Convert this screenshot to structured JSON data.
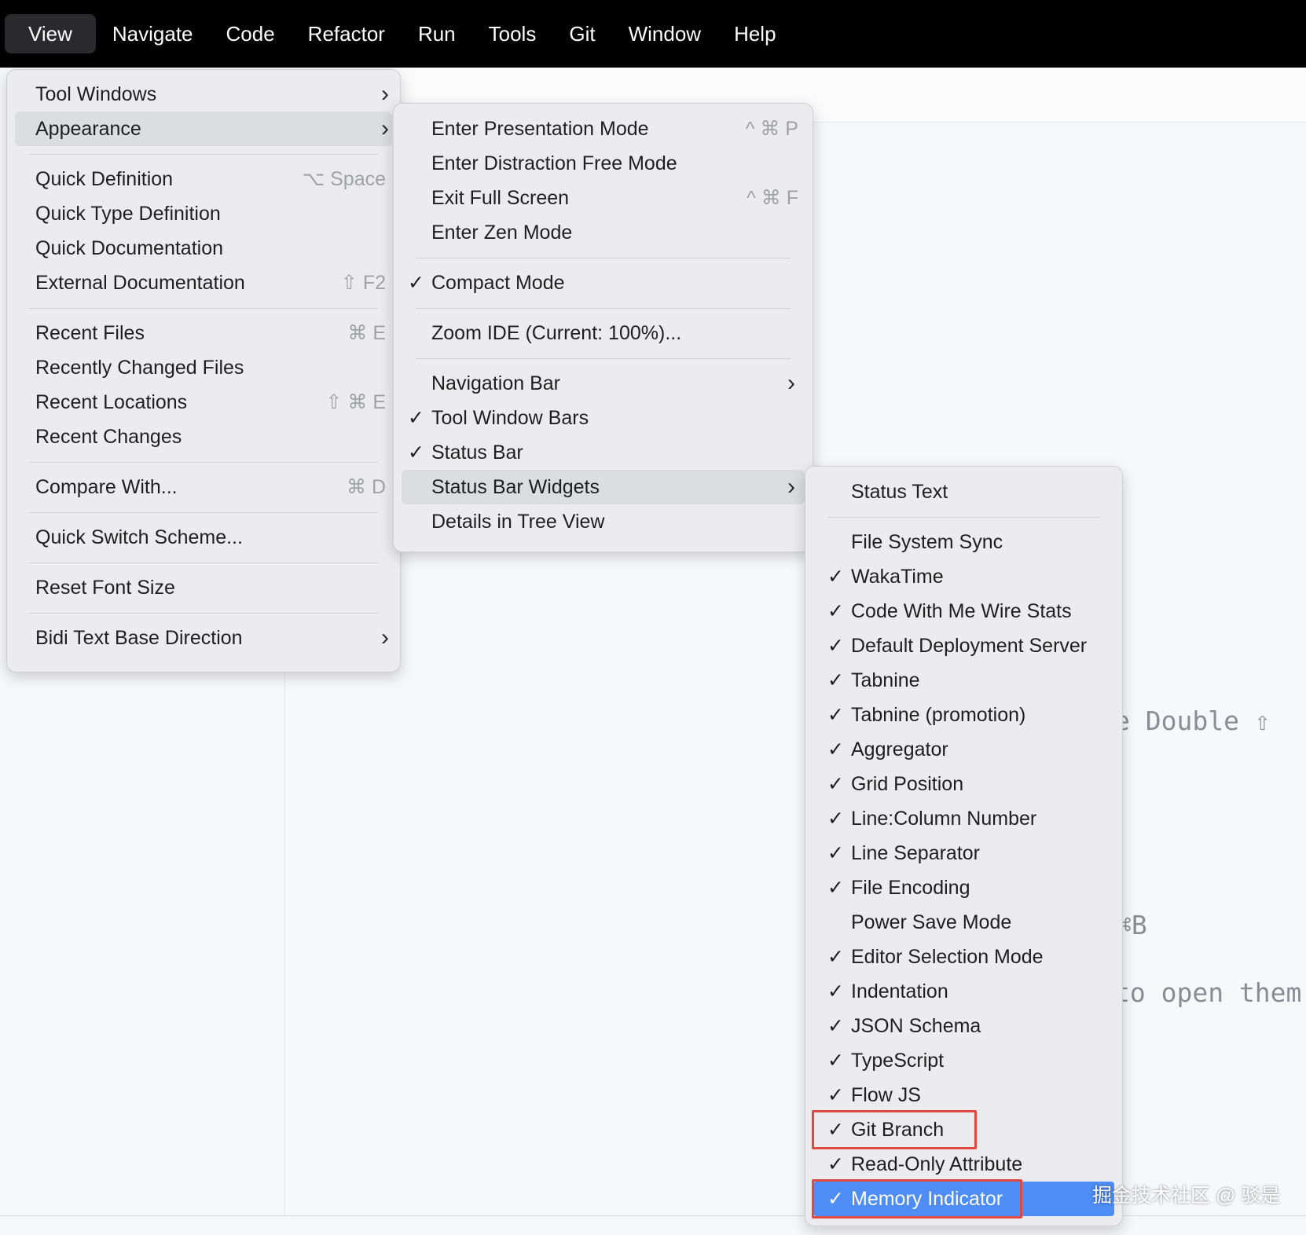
{
  "menubar": {
    "items": [
      "View",
      "Navigate",
      "Code",
      "Refactor",
      "Run",
      "Tools",
      "Git",
      "Window",
      "Help"
    ]
  },
  "editor": {
    "snippets": [
      "e Double ⇧",
      "⌘B",
      "to open them"
    ]
  },
  "view_menu": {
    "items": [
      {
        "label": "Tool Windows",
        "submenu": true
      },
      {
        "label": "Appearance",
        "submenu": true,
        "highlighted": true
      },
      {
        "separator": true
      },
      {
        "label": "Quick Definition",
        "shortcut": "⌥ Space"
      },
      {
        "label": "Quick Type Definition"
      },
      {
        "label": "Quick Documentation"
      },
      {
        "label": "External Documentation",
        "shortcut": "⇧ F2"
      },
      {
        "separator": true
      },
      {
        "label": "Recent Files",
        "shortcut": "⌘ E"
      },
      {
        "label": "Recently Changed Files"
      },
      {
        "label": "Recent Locations",
        "shortcut": "⇧ ⌘ E"
      },
      {
        "label": "Recent Changes"
      },
      {
        "separator": true
      },
      {
        "label": "Compare With...",
        "shortcut": "⌘ D"
      },
      {
        "separator": true
      },
      {
        "label": "Quick Switch Scheme..."
      },
      {
        "separator": true
      },
      {
        "label": "Reset Font Size"
      },
      {
        "separator": true
      },
      {
        "label": "Bidi Text Base Direction",
        "submenu": true
      }
    ]
  },
  "appearance_menu": {
    "items": [
      {
        "label": "Enter Presentation Mode",
        "shortcut": "^ ⌘ P"
      },
      {
        "label": "Enter Distraction Free Mode"
      },
      {
        "label": "Exit Full Screen",
        "shortcut": "^ ⌘ F"
      },
      {
        "label": "Enter Zen Mode"
      },
      {
        "separator": true
      },
      {
        "label": "Compact Mode",
        "checked": true
      },
      {
        "separator": true
      },
      {
        "label": "Zoom IDE (Current: 100%)..."
      },
      {
        "separator": true
      },
      {
        "label": "Navigation Bar",
        "submenu": true
      },
      {
        "label": "Tool Window Bars",
        "checked": true
      },
      {
        "label": "Status Bar",
        "checked": true
      },
      {
        "label": "Status Bar Widgets",
        "submenu": true,
        "highlighted": true
      },
      {
        "label": "Details in Tree View"
      }
    ]
  },
  "widgets_menu": {
    "items": [
      {
        "label": "Status Text"
      },
      {
        "separator": true
      },
      {
        "label": "File System Sync"
      },
      {
        "label": "WakaTime",
        "checked": true
      },
      {
        "label": "Code With Me Wire Stats",
        "checked": true
      },
      {
        "label": "Default Deployment Server",
        "checked": true
      },
      {
        "label": "Tabnine",
        "checked": true
      },
      {
        "label": "Tabnine (promotion)",
        "checked": true
      },
      {
        "label": "Aggregator",
        "checked": true
      },
      {
        "label": "Grid Position",
        "checked": true
      },
      {
        "label": "Line:Column Number",
        "checked": true
      },
      {
        "label": "Line Separator",
        "checked": true
      },
      {
        "label": "File Encoding",
        "checked": true
      },
      {
        "label": "Power Save Mode"
      },
      {
        "label": "Editor Selection Mode",
        "checked": true
      },
      {
        "label": "Indentation",
        "checked": true
      },
      {
        "label": "JSON Schema",
        "checked": true
      },
      {
        "label": "TypeScript",
        "checked": true
      },
      {
        "label": "Flow JS",
        "checked": true
      },
      {
        "label": "Git Branch",
        "checked": true,
        "annotated": true
      },
      {
        "label": "Read-Only Attribute",
        "checked": true
      },
      {
        "label": "Memory Indicator",
        "checked": true,
        "selected": true,
        "annotated": true
      }
    ]
  },
  "check_glyph": "✓",
  "watermark": "掘金技术社区 @ 驳是",
  "colors": {
    "menubar_bg": "#000000",
    "menu_bg": "#ececee",
    "highlight": "#dcdde1",
    "selection": "#4e8df5",
    "annotation": "#e0493f"
  }
}
